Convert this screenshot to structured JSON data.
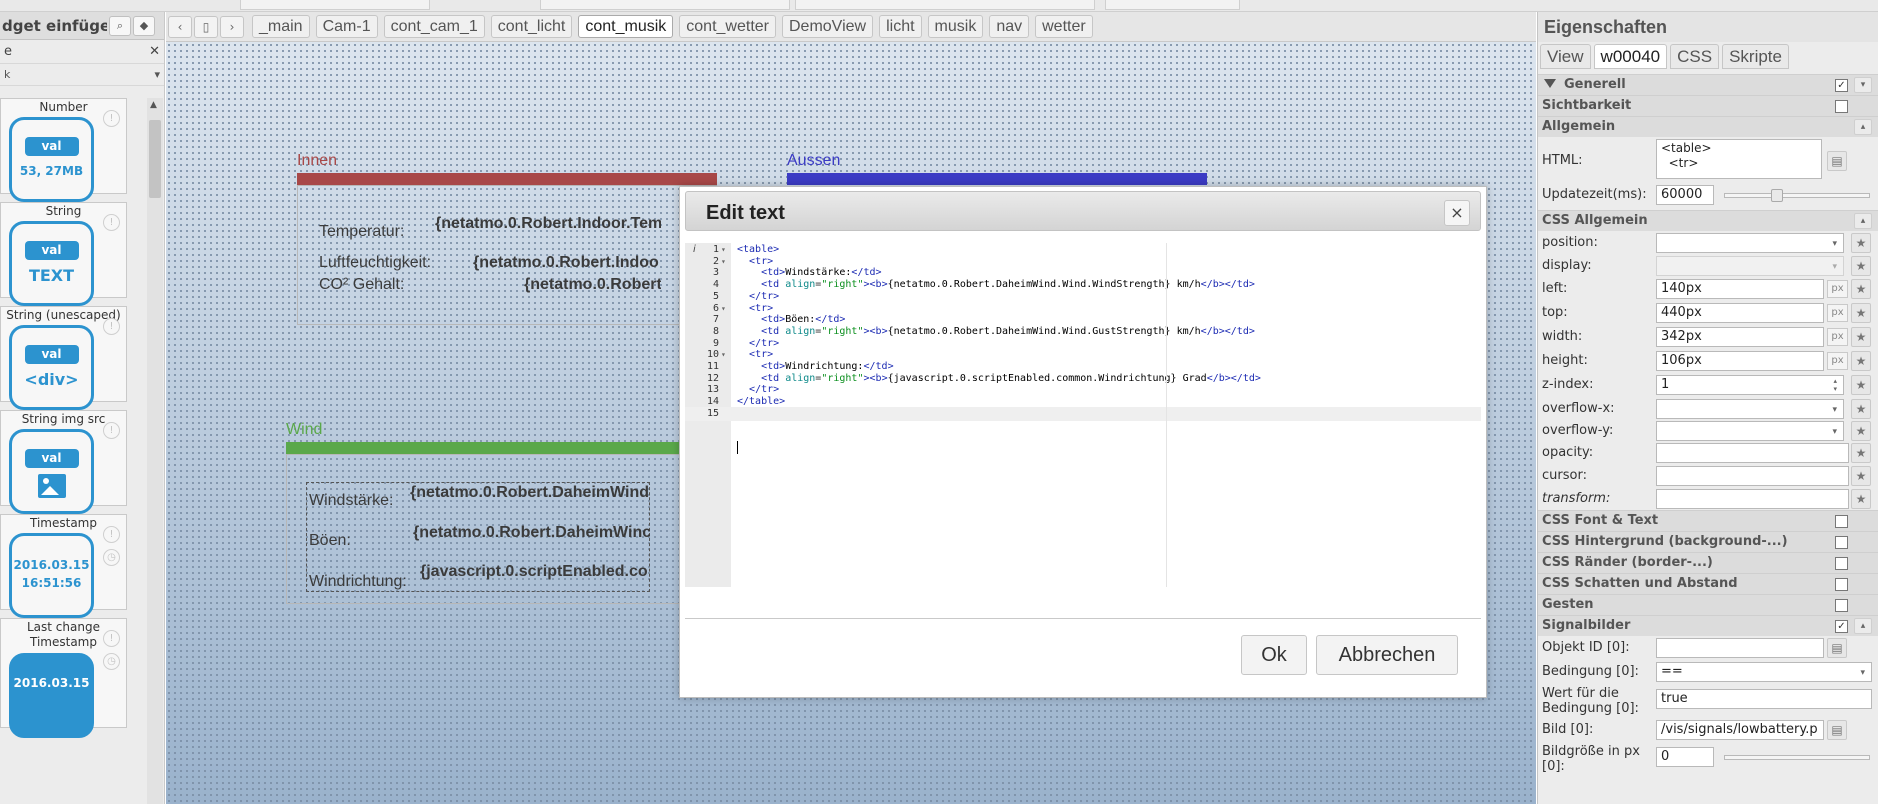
{
  "left_panel": {
    "title": "dget einfügen",
    "filter_value": "e",
    "category_value": "k",
    "widgets": [
      {
        "label": "Number",
        "badge": "val",
        "value": "53, 27MB"
      },
      {
        "label": "String",
        "badge": "val",
        "value": "TEXT"
      },
      {
        "label": "String (unescaped)",
        "badge": "val",
        "value": "<div>"
      },
      {
        "label": "String img src",
        "badge": "val",
        "value": ""
      },
      {
        "label": "Timestamp",
        "value": "2016.03.15 16:51:56"
      },
      {
        "label": "Last change Timestamp",
        "value": "2016.03.15"
      }
    ]
  },
  "toolbar": {
    "tabs": [
      "_main",
      "Cam-1",
      "cont_cam_1",
      "cont_licht",
      "cont_musik",
      "cont_wetter",
      "DemoView",
      "licht",
      "musik",
      "nav",
      "wetter"
    ],
    "active_tab": "cont_musik"
  },
  "canvas": {
    "innen": {
      "title": "Innen",
      "color": "#a84848",
      "rows": [
        {
          "label": "Temperatur:",
          "value": "{netatmo.0.Robert.Indoor.Tem"
        },
        {
          "label": "Luftfeuchtigkeit:",
          "value": "{netatmo.0.Robert.Indoo"
        },
        {
          "label": "CO² Gehalt:",
          "value": "{netatmo.0.Robert"
        }
      ]
    },
    "aussen": {
      "title": "Aussen",
      "color": "#3b3bc4"
    },
    "wind": {
      "title": "Wind",
      "color": "#5aa84a",
      "rows": [
        {
          "label": "Windstärke:",
          "value": "{netatmo.0.Robert.DaheimWind"
        },
        {
          "label": "Böen:",
          "value": "{netatmo.0.Robert.DaheimWinc"
        },
        {
          "label": "Windrichtung:",
          "value": "{javascript.0.scriptEnabled.co"
        }
      ]
    }
  },
  "properties": {
    "title": "Eigenschaften",
    "tabs": [
      "View",
      "w00040",
      "CSS",
      "Skripte"
    ],
    "active_tab": "w00040",
    "generell": "Generell",
    "sichtbarkeit": "Sichtbarkeit",
    "allgemein": "Allgemein",
    "html_label": "HTML:",
    "html_preview": [
      "<table>",
      "  <tr>"
    ],
    "update_label": "Updatezeit(ms):",
    "update_value": "60000",
    "css_allgemein": "CSS Allgemein",
    "css_props": [
      {
        "label": "position:",
        "value": "",
        "kind": "select"
      },
      {
        "label": "display:",
        "value": "",
        "kind": "select-disabled"
      },
      {
        "label": "left:",
        "value": "140px",
        "kind": "px"
      },
      {
        "label": "top:",
        "value": "440px",
        "kind": "px"
      },
      {
        "label": "width:",
        "value": "342px",
        "kind": "px"
      },
      {
        "label": "height:",
        "value": "106px",
        "kind": "px"
      },
      {
        "label": "z-index:",
        "value": "1",
        "kind": "spin"
      },
      {
        "label": "overflow-x:",
        "value": "",
        "kind": "select"
      },
      {
        "label": "overflow-y:",
        "value": "",
        "kind": "select"
      },
      {
        "label": "opacity:",
        "value": "",
        "kind": "text"
      },
      {
        "label": "cursor:",
        "value": "",
        "kind": "text"
      },
      {
        "label": "transform:",
        "value": "",
        "kind": "text-italic"
      }
    ],
    "groups": [
      {
        "label": "CSS Font & Text",
        "checked": false
      },
      {
        "label": "CSS Hintergrund (background-...)",
        "checked": false
      },
      {
        "label": "CSS Ränder (border-...)",
        "checked": false
      },
      {
        "label": "CSS Schatten und Abstand",
        "checked": false
      },
      {
        "label": "Gesten",
        "checked": false
      },
      {
        "label": "Signalbilder",
        "checked": true
      }
    ],
    "signal_fields": [
      {
        "label": "Objekt ID [0]:",
        "value": ""
      },
      {
        "label": "Bedingung [0]:",
        "value": "=="
      },
      {
        "label": "Wert für die Bedingung [0]:",
        "value": "true"
      },
      {
        "label": "Bild [0]:",
        "value": "/vis/signals/lowbattery.p"
      },
      {
        "label": "Bildgröße in px [0]:",
        "value": "0"
      }
    ]
  },
  "dialog": {
    "title": "Edit text",
    "close": "×",
    "ok": "Ok",
    "cancel": "Abbrechen",
    "lines": [
      "<table>",
      "  <tr>",
      "    <td>Windstärke:</td>",
      "    <td align=\"right\"><b>{netatmo.0.Robert.DaheimWind.Wind.WindStrength} km/h</b></td>",
      "  </tr>",
      "  <tr>",
      "    <td>Böen:</td>",
      "    <td align=\"right\"><b>{netatmo.0.Robert.DaheimWind.Wind.GustStrength} km/h</b></td>",
      "  </tr>",
      "  <tr>",
      "    <td>Windrichtung:</td>",
      "    <td align=\"right\"><b>{javascript.0.scriptEnabled.common.Windrichtung} Grad</b></td>",
      "  </tr>",
      "</table>",
      ""
    ],
    "folds": [
      1,
      2,
      6,
      10
    ]
  }
}
